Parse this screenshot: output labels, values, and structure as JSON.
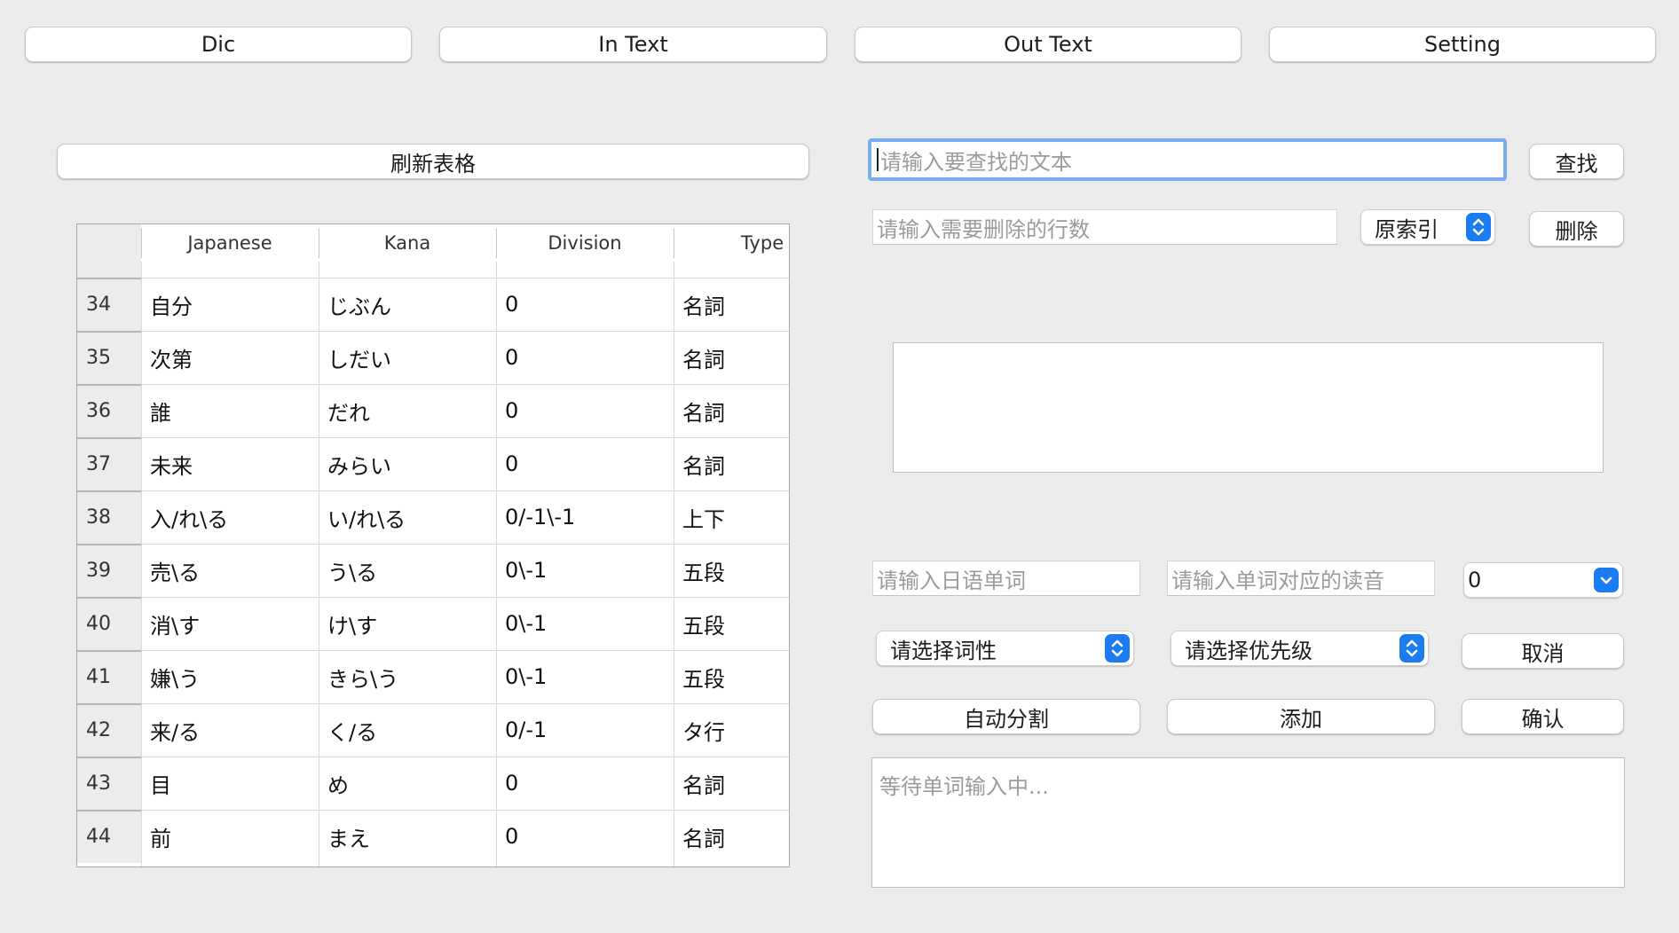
{
  "tabs": [
    "Dic",
    "In Text",
    "Out Text",
    "Setting"
  ],
  "refresh_button": "刷新表格",
  "table": {
    "columns": [
      "Japanese",
      "Kana",
      "Division",
      "Type"
    ],
    "rows": [
      {
        "index": "34",
        "japanese": "自分",
        "kana": "じぶん",
        "division": "0",
        "type": "名詞"
      },
      {
        "index": "35",
        "japanese": "次第",
        "kana": "しだい",
        "division": "0",
        "type": "名詞"
      },
      {
        "index": "36",
        "japanese": "誰",
        "kana": "だれ",
        "division": "0",
        "type": "名詞"
      },
      {
        "index": "37",
        "japanese": "未来",
        "kana": "みらい",
        "division": "0",
        "type": "名詞"
      },
      {
        "index": "38",
        "japanese": "入/れ\\る",
        "kana": "い/れ\\る",
        "division": "0/-1\\-1",
        "type": "上下"
      },
      {
        "index": "39",
        "japanese": "売\\る",
        "kana": "う\\る",
        "division": "0\\-1",
        "type": "五段"
      },
      {
        "index": "40",
        "japanese": "消\\す",
        "kana": "け\\す",
        "division": "0\\-1",
        "type": "五段"
      },
      {
        "index": "41",
        "japanese": "嫌\\う",
        "kana": "きら\\う",
        "division": "0\\-1",
        "type": "五段"
      },
      {
        "index": "42",
        "japanese": "来/る",
        "kana": "く/る",
        "division": "0/-1",
        "type": "タ行"
      },
      {
        "index": "43",
        "japanese": "目",
        "kana": "め",
        "division": "0",
        "type": "名詞"
      },
      {
        "index": "44",
        "japanese": "前",
        "kana": "まえ",
        "division": "0",
        "type": "名詞"
      }
    ]
  },
  "search": {
    "placeholder": "请输入要查找的文本",
    "button": "查找"
  },
  "delete": {
    "placeholder": "请输入需要删除的行数",
    "index_select": "原索引",
    "button": "删除"
  },
  "word_input": {
    "japanese_placeholder": "请输入日语单词",
    "reading_placeholder": "请输入单词对应的读音",
    "number_select": "0",
    "pos_select": "请选择词性",
    "priority_select": "请选择优先级",
    "cancel_button": "取消",
    "auto_split_button": "自动分割",
    "add_button": "添加",
    "confirm_button": "确认"
  },
  "log_placeholder": "等待单词输入中...",
  "colors": {
    "accent": "#1c7cf2",
    "focus_ring": "#7aacee",
    "background": "#ececec"
  }
}
